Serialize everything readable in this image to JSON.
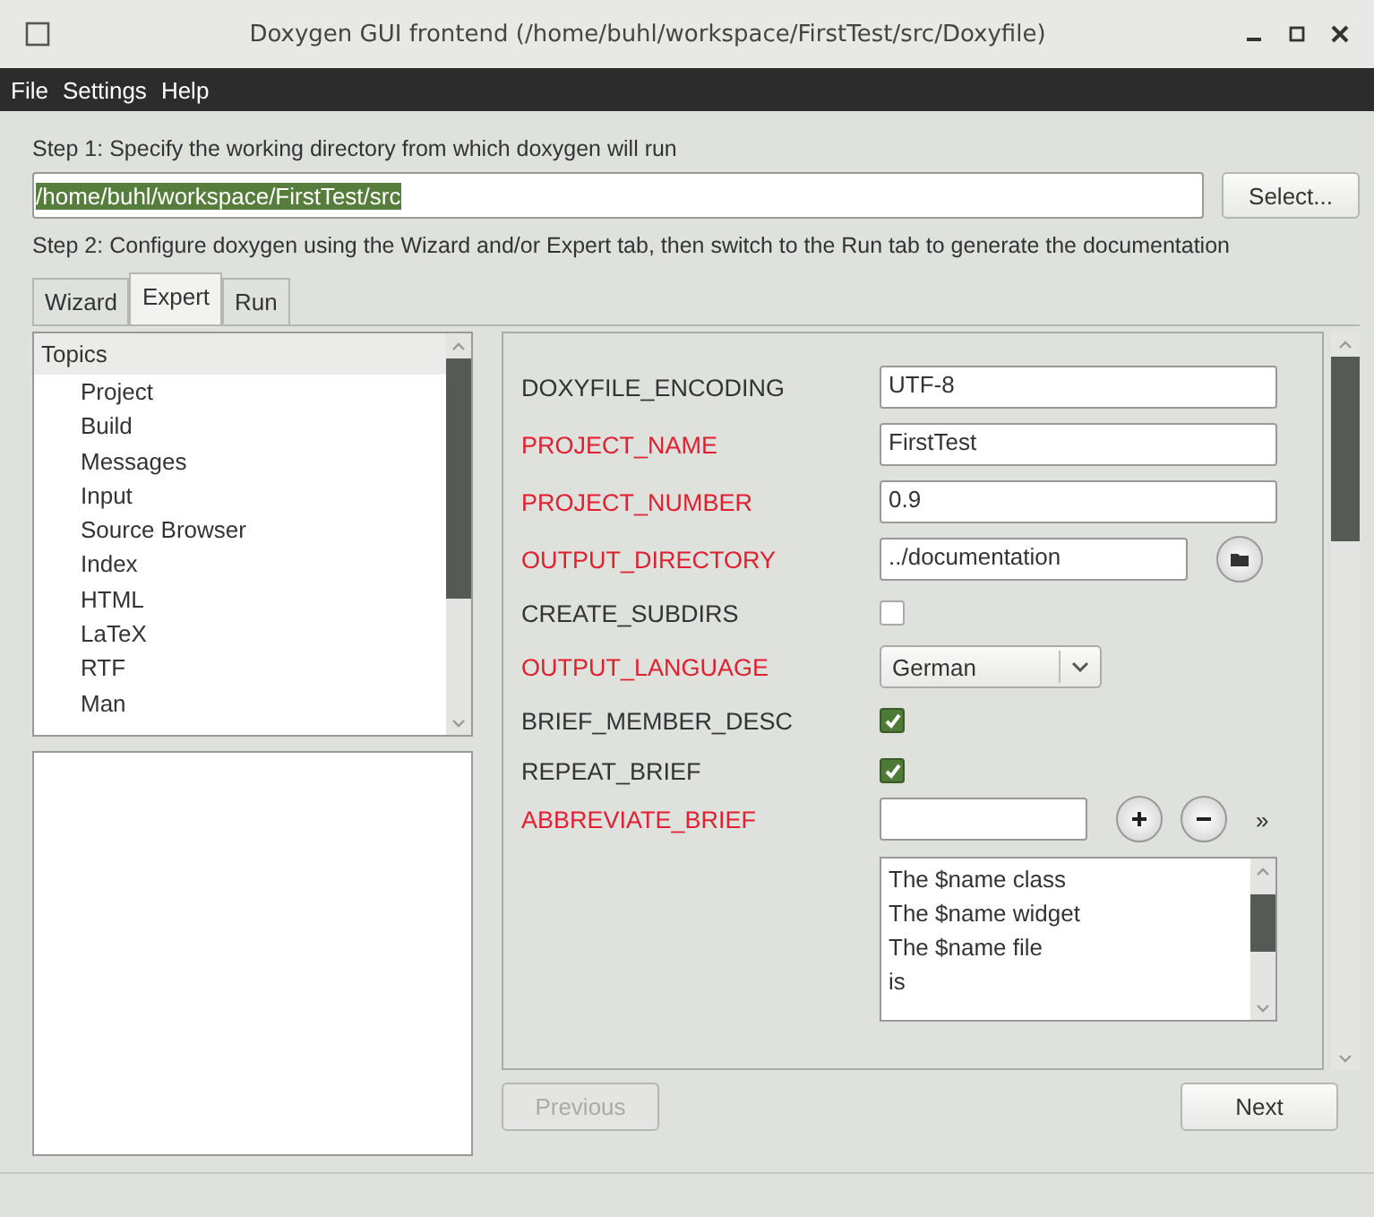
{
  "window": {
    "title": "Doxygen GUI frontend (/home/buhl/workspace/FirstTest/src/Doxyfile)"
  },
  "menu": [
    "File",
    "Settings",
    "Help"
  ],
  "step1": {
    "label": "Step 1: Specify the working directory from which doxygen will run",
    "value": "/home/buhl/workspace/FirstTest/src",
    "value_selected": true,
    "button": "Select..."
  },
  "step2": {
    "label": "Step 2: Configure doxygen using the Wizard and/or Expert tab, then switch to the Run tab to generate the documentation"
  },
  "tabs": [
    {
      "label": "Wizard",
      "selected": false
    },
    {
      "label": "Expert",
      "selected": true
    },
    {
      "label": "Run",
      "selected": false
    }
  ],
  "topics": {
    "header": "Topics",
    "items": [
      {
        "label": "Project"
      },
      {
        "label": "Build"
      },
      {
        "label": "Messages"
      },
      {
        "label": "Input"
      },
      {
        "label": "Source Browser"
      },
      {
        "label": "Index"
      },
      {
        "label": "HTML"
      },
      {
        "label": "LaTeX"
      },
      {
        "label": "RTF"
      },
      {
        "label": "Man"
      }
    ]
  },
  "settings": [
    {
      "kind": "text",
      "name": "DOXYFILE_ENCODING",
      "modified": false,
      "value": "UTF-8"
    },
    {
      "kind": "text",
      "name": "PROJECT_NAME",
      "modified": true,
      "value": "FirstTest"
    },
    {
      "kind": "text",
      "name": "PROJECT_NUMBER",
      "modified": true,
      "value": "0.9"
    },
    {
      "kind": "dir",
      "name": "OUTPUT_DIRECTORY",
      "modified": true,
      "value": "../documentation"
    },
    {
      "kind": "checkbox",
      "name": "CREATE_SUBDIRS",
      "modified": false,
      "checked": false
    },
    {
      "kind": "combo",
      "name": "OUTPUT_LANGUAGE",
      "modified": true,
      "value": "German"
    },
    {
      "kind": "checkbox",
      "name": "BRIEF_MEMBER_DESC",
      "modified": false,
      "checked": true
    },
    {
      "kind": "checkbox",
      "name": "REPEAT_BRIEF",
      "modified": false,
      "checked": true
    },
    {
      "kind": "list",
      "name": "ABBREVIATE_BRIEF",
      "modified": true,
      "more": "»",
      "items": [
        "The $name class",
        "The $name widget",
        "The $name file",
        "is"
      ]
    }
  ],
  "nav": [
    {
      "label": "Previous",
      "disabled": true
    },
    {
      "label": "Next",
      "disabled": false
    }
  ]
}
